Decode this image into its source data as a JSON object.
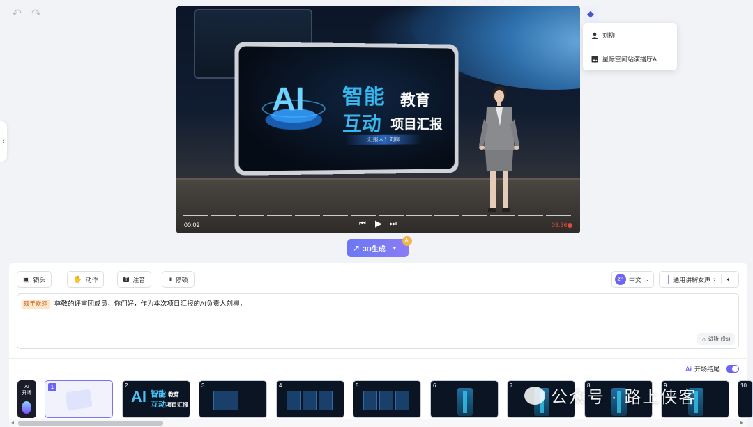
{
  "toolbar_top": {
    "undo_icon": "undo-icon",
    "redo_icon": "redo-icon"
  },
  "video": {
    "slide": {
      "logo": "AI",
      "title_line1_main": "智能",
      "title_line1_sub": "教育",
      "title_line2_main": "互动",
      "title_line2_sub": "项目汇报",
      "reporter": "汇报人：刘柳"
    },
    "time_current": "00:02",
    "time_total": "03:36",
    "progress_fraction": 0.01
  },
  "layers_menu": {
    "items": [
      {
        "icon": "user-icon",
        "label": "刘柳"
      },
      {
        "icon": "image-icon",
        "label": "星际空间站演播厅A"
      }
    ]
  },
  "generate": {
    "label": "3D生成",
    "badge": "AI"
  },
  "editor": {
    "tools": [
      {
        "icon": "camera-icon",
        "label": "镜头"
      },
      {
        "icon": "gesture-icon",
        "label": "动作"
      },
      {
        "icon": "text-icon",
        "label": "注音"
      },
      {
        "icon": "pause-icon",
        "label": "停顿"
      }
    ],
    "language": {
      "code": "zh",
      "label": "中文"
    },
    "voice": {
      "label": "通用讲解女声"
    },
    "script": {
      "tag": "双手欢迎",
      "text": "尊敬的评审团成员，你们好，作为本次项目汇报的AI负责人刘柳，"
    },
    "listen_label": "试听 (9s)",
    "ending": {
      "ai": "Ai",
      "label": "开场结尾",
      "enabled": true
    }
  },
  "timeline": {
    "opener": {
      "line1": "AI",
      "line2": "开场"
    },
    "thumbs": [
      "1",
      "2",
      "3",
      "4",
      "5",
      "6",
      "7",
      "8",
      "9",
      "10"
    ],
    "thumb2": {
      "logo": "AI",
      "line1": "智能",
      "sub1": "教育",
      "line2": "互动",
      "sub2": "项目汇报"
    },
    "selected": 1
  },
  "watermark": "公众号 · 路上侠客"
}
